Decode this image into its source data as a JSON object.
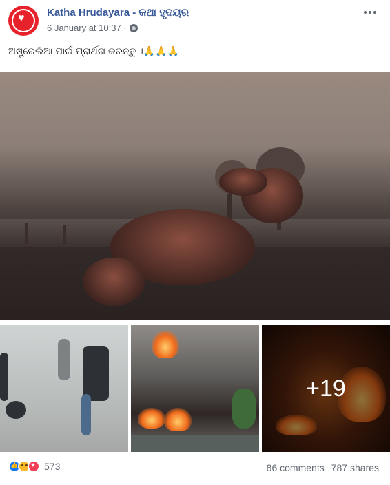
{
  "post": {
    "page_name": "Katha Hrudayara - କଥା ହୃଦୟର",
    "timestamp": "6 January at 10:37 ·",
    "privacy_icon": "globe-icon",
    "text": "ଅଷ୍ଟ୍ରେଲିଆ ପାଇଁ ପ୍ରାର୍ଥନା କରନ୍ତୁ ।🙏🙏🙏",
    "more_photos_label": "+19",
    "reactions": [
      "like",
      "sad",
      "love"
    ],
    "reaction_count": "573",
    "comments": "86 comments",
    "shares": "787 shares",
    "colors": {
      "page_name": "#385898",
      "secondary_text": "#606770",
      "avatar_bg": "#e8222a"
    }
  }
}
